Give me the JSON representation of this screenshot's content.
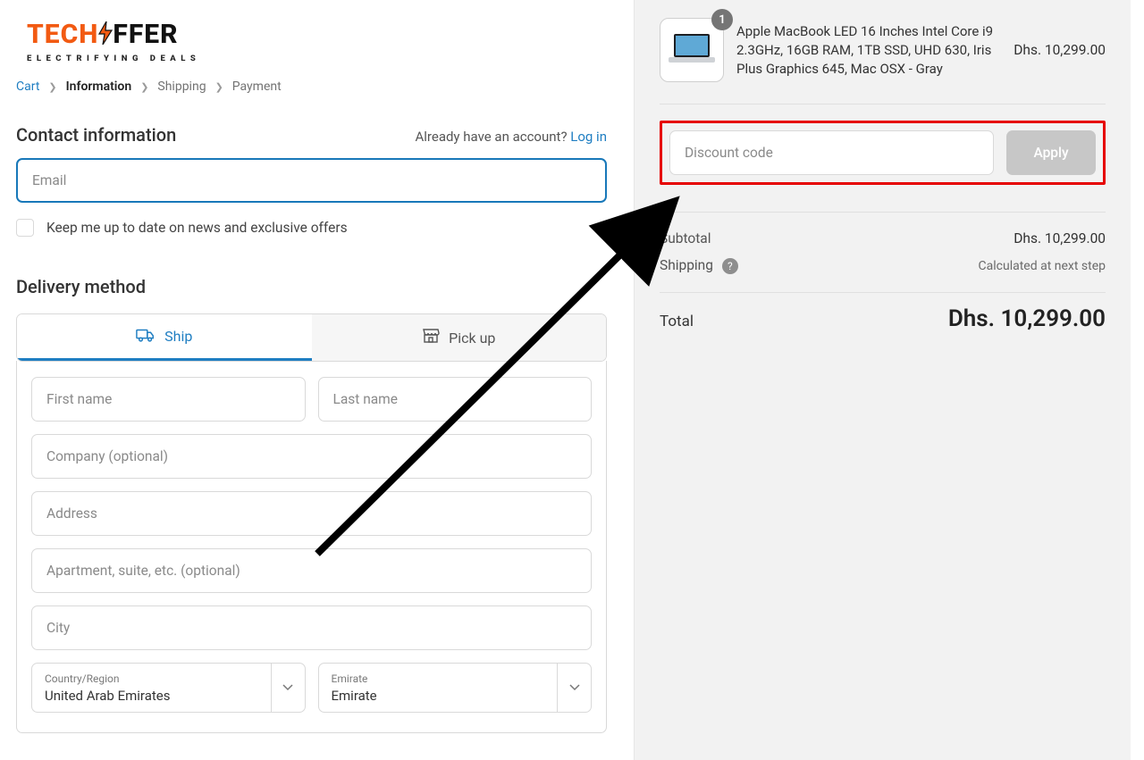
{
  "logo": {
    "part1": "TECH",
    "part2": "FFER",
    "tagline": "ELECTRIFYING DEALS"
  },
  "breadcrumbs": {
    "cart": "Cart",
    "information": "Information",
    "shipping": "Shipping",
    "payment": "Payment"
  },
  "contact": {
    "heading": "Contact information",
    "login_prompt": "Already have an account?",
    "login_link": "Log in",
    "email_placeholder": "Email",
    "newsletter_label": "Keep me up to date on news and exclusive offers"
  },
  "delivery": {
    "heading": "Delivery method",
    "ship_tab": "Ship",
    "pickup_tab": "Pick up",
    "first_name": "First name",
    "last_name": "Last name",
    "company": "Company (optional)",
    "address": "Address",
    "apartment": "Apartment, suite, etc. (optional)",
    "city": "City",
    "country_label": "Country/Region",
    "country_value": "United Arab Emirates",
    "emirate_label": "Emirate",
    "emirate_value": "Emirate"
  },
  "cart": {
    "qty_badge": "1",
    "item_name": "Apple MacBook LED 16 Inches Intel Core i9 2.3GHz, 16GB RAM, 1TB SSD, UHD 630, Iris Plus Graphics 645, Mac OSX - Gray",
    "item_price": "Dhs. 10,299.00"
  },
  "promo": {
    "placeholder": "Discount code",
    "apply_label": "Apply"
  },
  "summary": {
    "subtotal_label": "Subtotal",
    "subtotal_value": "Dhs. 10,299.00",
    "shipping_label": "Shipping",
    "shipping_value": "Calculated at next step",
    "total_label": "Total",
    "total_value": "Dhs. 10,299.00"
  }
}
